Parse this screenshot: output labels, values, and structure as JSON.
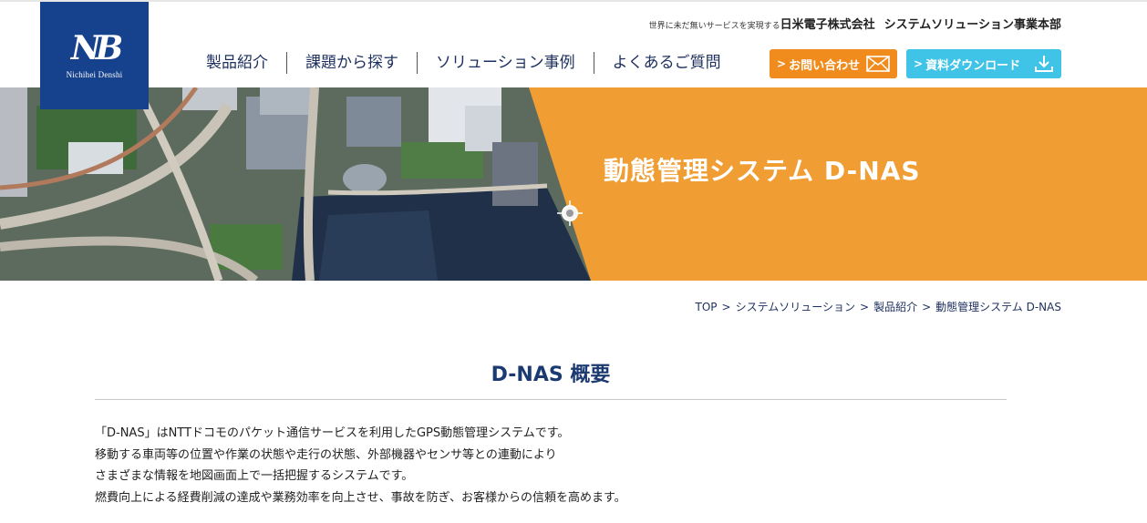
{
  "header": {
    "logo": {
      "mark": "NB",
      "text": "Nichihei Denshi"
    },
    "tagline": "世界に未だ無いサービスを実現する",
    "company": "日米電子株式会社",
    "division": "システムソリューション事業本部",
    "nav": [
      "製品紹介",
      "課題から探す",
      "ソリューション事例",
      "よくあるご質問"
    ],
    "contact_button": {
      "chevron": ">",
      "label": "お問い合わせ",
      "icon": "mail-icon",
      "color": "#f08c1e"
    },
    "download_button": {
      "chevron": ">",
      "label": "資料ダウンロード",
      "icon": "download-icon",
      "color": "#3fc3e6"
    }
  },
  "hero": {
    "title": "動態管理システム D-NAS",
    "accent_color": "#f09d33"
  },
  "breadcrumb": [
    "TOP",
    "システムソリューション",
    "製品紹介",
    "動態管理システム D-NAS"
  ],
  "breadcrumb_separator": ">",
  "section": {
    "title": "D-NAS 概要",
    "paragraphs": [
      "「D-NAS」はNTTドコモのパケット通信サービスを利用したGPS動態管理システムです。",
      "移動する車両等の位置や作業の状態や走行の状態、外部機器やセンサ等との連動により",
      "さまざまな情報を地図画面上で一括把握するシステムです。",
      "燃費向上による経費削減の達成や業務効率を向上させ、事故を防ぎ、お客様からの信頼を高めます。"
    ]
  }
}
